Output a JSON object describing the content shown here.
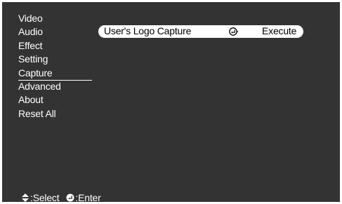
{
  "menu": {
    "items": [
      {
        "label": "Video"
      },
      {
        "label": "Audio"
      },
      {
        "label": "Effect"
      },
      {
        "label": "Setting"
      },
      {
        "label": "Capture"
      },
      {
        "label": "Advanced"
      },
      {
        "label": "About"
      },
      {
        "label": "Reset All"
      }
    ],
    "selected": "Capture"
  },
  "submenu": {
    "item_label": "User's Logo Capture",
    "action_label": "Execute",
    "action_icon": "enter-icon"
  },
  "statusbar": {
    "select_icon": "up-down-arrow-icon",
    "select_label": ":Select",
    "enter_icon": "enter-icon",
    "enter_label": ":Enter"
  }
}
